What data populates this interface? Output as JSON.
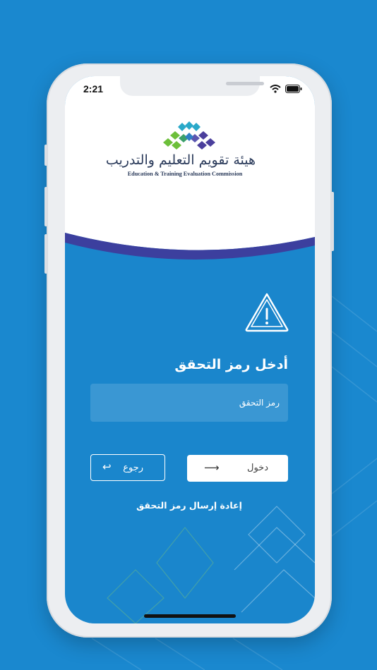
{
  "status_bar": {
    "time": "2:21"
  },
  "logo": {
    "name_ar": "هيئة تقويم التعليم والتدريب",
    "name_en": "Education & Training Evaluation Commission"
  },
  "page": {
    "title": "أدخل رمز التحقق"
  },
  "verification": {
    "placeholder": "رمز التحقق",
    "value": ""
  },
  "buttons": {
    "login_label": "دخول",
    "back_label": "رجوع",
    "resend_label": "إعادة إرسال رمز التحقق"
  },
  "colors": {
    "background": "#1a88cf",
    "screen_blue": "#1a86cc",
    "wave_accent": "#3c3f9e",
    "logo_teal": "#2aa9c9",
    "logo_green": "#6cbf3a",
    "logo_purple": "#4b3f9c"
  },
  "icons": {
    "warning": "warning-triangle-icon",
    "login_arrow": "arrow-right-icon",
    "back_arrow": "return-arrow-icon",
    "wifi": "wifi-icon",
    "battery": "battery-icon"
  }
}
